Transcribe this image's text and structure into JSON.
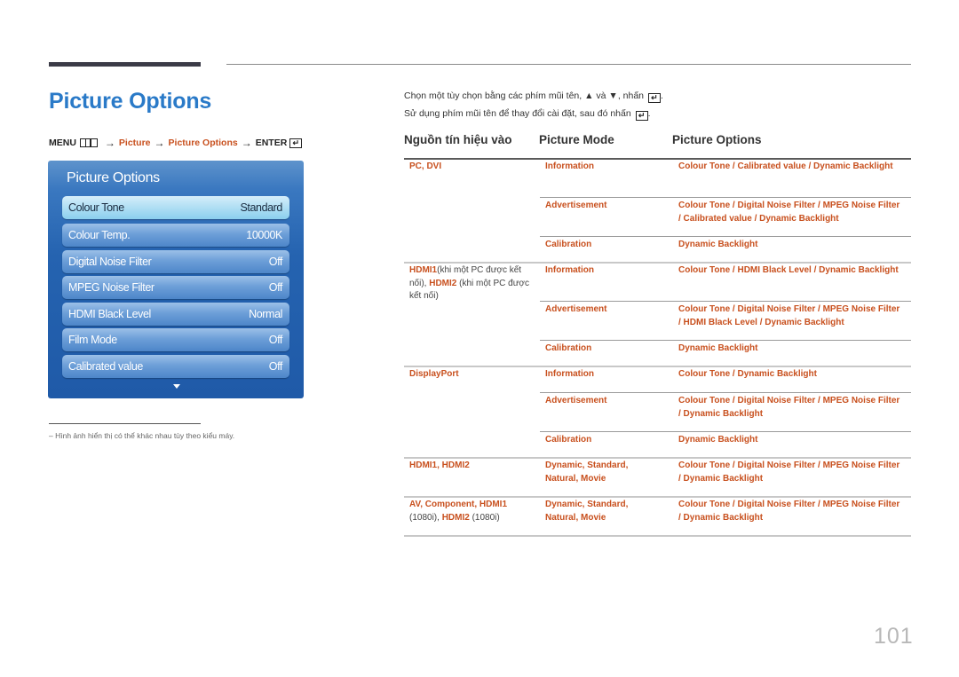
{
  "page": {
    "title": "Picture Options",
    "page_number": "101"
  },
  "menu_path": {
    "menu": "MENU",
    "arrow": "→",
    "step1": "Picture",
    "step2": "Picture Options",
    "enter": "ENTER"
  },
  "osd": {
    "title": "Picture Options",
    "items": [
      {
        "label": "Colour Tone",
        "value": "Standard",
        "selected": true
      },
      {
        "label": "Colour Temp.",
        "value": "10000K"
      },
      {
        "label": "Digital Noise Filter",
        "value": "Off"
      },
      {
        "label": "MPEG Noise Filter",
        "value": "Off"
      },
      {
        "label": "HDMI Black Level",
        "value": "Normal"
      },
      {
        "label": "Film Mode",
        "value": "Off"
      },
      {
        "label": "Calibrated value",
        "value": "Off"
      }
    ],
    "scroll_icon": "down-arrow-icon"
  },
  "footnote": "–  Hình ảnh hiển thị có thể khác nhau tùy theo kiểu máy.",
  "instructions": {
    "line1_a": "Chọn một tùy chọn bằng các phím mũi tên, ▲ và ▼, nhấn",
    "line2_a": "Sử dụng phím mũi tên để thay đổi cài đặt, sau đó nhấn",
    "period": "."
  },
  "table": {
    "headers": [
      "Nguồn tín hiệu vào",
      "Picture Mode",
      "Picture Options"
    ],
    "sources": {
      "pc_dvi": "PC, DVI",
      "hdmi_pc_1": "HDMI1",
      "hdmi_pc_2": "(khi một PC được kết nối), ",
      "hdmi_pc_3": "HDMI2",
      "hdmi_pc_4": " (khi một PC được kết nối)",
      "displayport": "DisplayPort",
      "hdmi12": "HDMI1, HDMI2",
      "av_1": "AV, Component, HDMI1",
      "av_2": "(1080i), ",
      "av_3": "HDMI2",
      "av_4": " (1080i)"
    },
    "modes": {
      "information": "Information",
      "advertisement": "Advertisement",
      "calibration": "Calibration",
      "dsnm": "Dynamic, Standard, Natural, Movie"
    },
    "options": {
      "pc_info": "Colour Tone / Calibrated value / Dynamic Backlight",
      "pc_adv": "Colour Tone / Digital Noise Filter / MPEG Noise Filter / Calibrated value / Dynamic Backlight",
      "pc_cal": "Dynamic Backlight",
      "hdmi_info": "Colour Tone / HDMI Black Level / Dynamic Backlight",
      "hdmi_adv": "Colour Tone / Digital Noise Filter / MPEG Noise Filter / HDMI Black Level / Dynamic Backlight",
      "hdmi_cal": "Dynamic Backlight",
      "dp_info": "Colour Tone / Dynamic Backlight",
      "dp_adv": "Colour Tone / Digital Noise Filter / MPEG Noise Filter / Dynamic Backlight",
      "dp_cal": "Dynamic Backlight",
      "hdmi12_opts": "Colour Tone / Digital Noise Filter / MPEG Noise Filter / Dynamic Backlight",
      "av_opts": "Colour Tone / Digital Noise Filter / MPEG Noise Filter / Dynamic Backlight"
    }
  },
  "colors": {
    "title_blue": "#2a7ac8",
    "highlight_orange": "#c8501e",
    "osd_blue": "#1f5aa8"
  }
}
